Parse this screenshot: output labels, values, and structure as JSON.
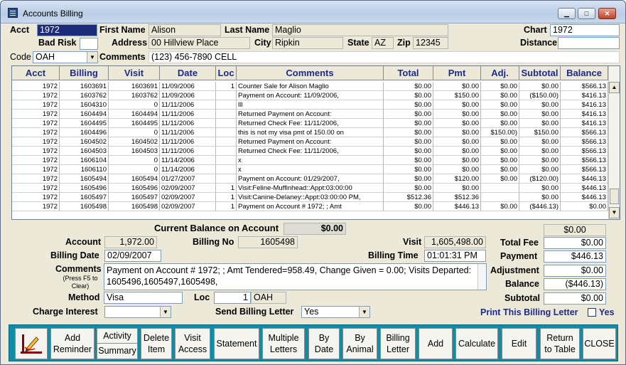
{
  "window": {
    "title": "Accounts Billing",
    "min_glyph": "▁",
    "max_glyph": "□",
    "close_glyph": "✕"
  },
  "header": {
    "acct_label": "Acct",
    "acct": "1972",
    "first_name_label": "First Name",
    "first_name": "Alison",
    "last_name_label": "Last Name",
    "last_name": "Maglio",
    "chart_label": "Chart",
    "chart": "1972",
    "bad_risk_label": "Bad Risk",
    "bad_risk": "",
    "address_label": "Address",
    "address": "00 Hillview Place",
    "city_label": "City",
    "city": "Ripkin",
    "state_label": "State",
    "state": "AZ",
    "zip_label": "Zip",
    "zip": "12345",
    "distance_label": "Distance",
    "distance": "",
    "code_label": "Code",
    "code": "OAH",
    "comments_label": "Comments",
    "comments": "(123) 456-7890   CELL"
  },
  "grid": {
    "columns": [
      "Acct",
      "Billing",
      "Visit",
      "Date",
      "Loc",
      "Comments",
      "Total",
      "Pmt",
      "Adj.",
      "Subtotal",
      "Balance"
    ],
    "rows": [
      [
        "1972",
        "1603691",
        "1603691",
        "11/09/2006",
        "1",
        "Counter Sale for Alison Maglio",
        "$0.00",
        "$0.00",
        "$0.00",
        "$0.00",
        "$566.13"
      ],
      [
        "1972",
        "1603762",
        "1603762",
        "11/09/2006",
        "",
        "Payment on Account: 11/09/2006,",
        "$0.00",
        "$150.00",
        "$0.00",
        "($150.00)",
        "$416.13"
      ],
      [
        "1972",
        "1604310",
        "0",
        "11/11/2006",
        "",
        "lll",
        "$0.00",
        "$0.00",
        "$0.00",
        "$0.00",
        "$416.13"
      ],
      [
        "1972",
        "1604494",
        "1604494",
        "11/11/2006",
        "",
        "Returned Payment on Account:",
        "$0.00",
        "$0.00",
        "$0.00",
        "$0.00",
        "$416.13"
      ],
      [
        "1972",
        "1604495",
        "1604495",
        "11/11/2006",
        "",
        "Returned Check Fee: 11/11/2006,",
        "$0.00",
        "$0.00",
        "$0.00",
        "$0.00",
        "$416.13"
      ],
      [
        "1972",
        "1604496",
        "0",
        "11/11/2006",
        "",
        "this is not my visa pmt of 150.00  on",
        "$0.00",
        "$0.00",
        "$150.00)",
        "$150.00",
        "$566.13"
      ],
      [
        "1972",
        "1604502",
        "1604502",
        "11/11/2006",
        "",
        "Returned Payment on Account:",
        "$0.00",
        "$0.00",
        "$0.00",
        "$0.00",
        "$566.13"
      ],
      [
        "1972",
        "1604503",
        "1604503",
        "11/11/2006",
        "",
        "Returned Check Fee: 11/11/2006,",
        "$0.00",
        "$0.00",
        "$0.00",
        "$0.00",
        "$566.13"
      ],
      [
        "1972",
        "1606104",
        "0",
        "11/14/2006",
        "",
        "x",
        "$0.00",
        "$0.00",
        "$0.00",
        "$0.00",
        "$566.13"
      ],
      [
        "1972",
        "1606110",
        "0",
        "11/14/2006",
        "",
        "x",
        "$0.00",
        "$0.00",
        "$0.00",
        "$0.00",
        "$566.13"
      ],
      [
        "1972",
        "1605494",
        "1605494",
        "01/27/2007",
        "",
        "Payment on Account: 01/29/2007,",
        "$0.00",
        "$120.00",
        "$0.00",
        "($120.00)",
        "$446.13"
      ],
      [
        "1972",
        "1605496",
        "1605496",
        "02/09/2007",
        "1",
        "Visit:Feline-Muffinhead::Appt:03:00:00",
        "$0.00",
        "$0.00",
        "",
        "$0.00",
        "$446.13"
      ],
      [
        "1972",
        "1605497",
        "1605497",
        "02/09/2007",
        "1",
        "Visit:Canine-Delaney::Appt:03:00:00 PM,",
        "$512.36",
        "$512.36",
        "",
        "$0.00",
        "$446.13"
      ],
      [
        "1972",
        "1605498",
        "1605498",
        "02/09/2007",
        "1",
        "Payment on Account # 1972; ; Amt",
        "$0.00",
        "$446.13",
        "$0.00",
        "($446.13)",
        "$0.00"
      ]
    ]
  },
  "summary": {
    "current_balance_label": "Current Balance on Account",
    "current_balance": "$0.00",
    "right_balance": "$0.00",
    "account_label": "Account",
    "account": "1,972.00",
    "billing_no_label": "Billing No",
    "billing_no": "1605498",
    "visit_label": "Visit",
    "visit": "1,605,498.00",
    "billing_date_label": "Billing Date",
    "billing_date": "02/09/2007",
    "billing_time_label": "Billing Time",
    "billing_time": "01:01:31 PM",
    "comments_label": "Comments",
    "comments_hint": "(Press F5 to Clear)",
    "comments": "Payment on Account # 1972; ; Amt Tendered=958.49, Change Given = 0.00; Visits Departed: 1605496,1605497,1605498,",
    "method_label": "Method",
    "method": "Visa",
    "loc_label": "Loc",
    "loc_num": "1",
    "loc_code": "OAH",
    "charge_interest_label": "Charge Interest",
    "charge_interest": "",
    "send_billing_letter_label": "Send Billing Letter",
    "send_billing_letter": "Yes",
    "total_fee_label": "Total Fee",
    "total_fee": "$0.00",
    "payment_label": "Payment",
    "payment": "$446.13",
    "adjustment_label": "Adjustment",
    "adjustment": "$0.00",
    "balance_label": "Balance",
    "balance": "($446.13)",
    "subtotal_label": "Subtotal",
    "subtotal": "$0.00",
    "print_letter_label": "Print This Billing Letter",
    "print_letter_yes": "Yes"
  },
  "toolbar": {
    "add_reminder": "Add Reminder",
    "activity": "Activity",
    "summary": "Summary",
    "delete_item": "Delete Item",
    "visit_access": "Visit Access",
    "statement": "Statement",
    "multiple_letters": "Multiple Letters",
    "by_date": "By Date",
    "by_animal": "By Animal",
    "billing_letter": "Billing Letter",
    "add": "Add",
    "calculate": "Calculate",
    "edit": "Edit",
    "return_to_table": "Return to Table",
    "close": "CLOSE"
  },
  "colors": {
    "accent": "#1c2a8c",
    "toolbar_bg": "#0e8ca8",
    "selected_field": "#1e2a7a"
  }
}
